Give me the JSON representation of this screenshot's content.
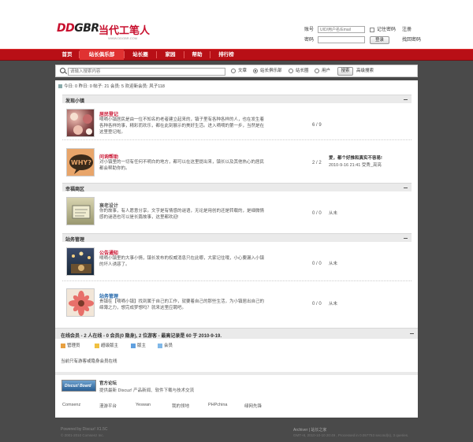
{
  "header": {
    "logo_text_1": "DD",
    "logo_text_2": "GBR",
    "logo_cn": "当代工笔人",
    "logo_sub": "WWW.DDGBR.COM"
  },
  "login": {
    "username_label": "账号",
    "username_placeholder": "UID/用户名/Email",
    "password_label": "密码",
    "remember_label": "记住密码",
    "register_label": "注册",
    "login_button": "登录",
    "forgot_label": "找回密码"
  },
  "nav": {
    "items": [
      "首页",
      "站长俱乐部",
      "站长圈",
      "家园",
      "帮助",
      "排行榜"
    ]
  },
  "search": {
    "placeholder": "请输入搜索内容",
    "options": [
      "文章",
      "站长俱乐部",
      "站长圈",
      "用户"
    ],
    "selected": "站长俱乐部",
    "button": "搜索",
    "advanced": "高级搜索"
  },
  "stats": {
    "text": "今日: 0  昨日: 0  帖子: 21  会员: 5  欢迎新会员: 风子118"
  },
  "sections": [
    {
      "title": "发现小镇",
      "forums": [
        {
          "name": "居民登记",
          "name_color": "#c8102e",
          "desc": "嘀嘀小镇居民是由一位不知名的老者建立起来的，镇子里有各种各样的人，也在发生着各种各样的事，精彩而欢乐，都在此刻展示的美好生活。进入嘀嘀的第一步，当然是在这里登记啦。",
          "count": "6 / 9",
          "last": ""
        },
        {
          "name": "问询帮助",
          "name_color": "#c8102e",
          "desc": "对小镇里的一切有任何不明白的地方，都可以在这里提出来，镇长以及其他热心的居民都会帮助你的。",
          "count": "2 / 2",
          "last_title": "爱，都个好推和真实不容易!",
          "last_meta": "2010-9-16 21:41 受秀_亮亮"
        }
      ]
    },
    {
      "title": "幸福商区",
      "forums": [
        {
          "name": "衰老设计",
          "name_color": "#555555",
          "desc": "你的故事，有人愿意分享。文字是有情感的谜语，无论是用创的还是转载的，是细微情感的谜语也可以是长篇故事，这里都欢迎!",
          "count": "0 / 0",
          "last": "从未"
        }
      ]
    },
    {
      "title": "站务管理",
      "forums": [
        {
          "name": "公告通知",
          "name_color": "#c8102e",
          "desc": "嘀嘀小镇里的大事小情，镇长发布的权威消息只在此哪，大家记住哦，小心要漏入小镇的坏人诱惑了。",
          "count": "0 / 0",
          "last": "从未"
        },
        {
          "name": "站务管理",
          "name_color": "#2266aa",
          "desc": "贵镇在【嘀嘀小镇】找到属于自己的工作，就要着自己的那些生活，为小镇居出自己的绵薄之力，想完成梦想吗？就来这里应聘吧。",
          "count": "0 / 0",
          "last": "从未"
        }
      ]
    }
  ],
  "online": {
    "title": "在线会员 - 2 人在线 - 0 会员(0 隐身), 2 位游客 - 最高记录是 60 于 2010-9-19.",
    "legend": [
      "管理员",
      "超级版主",
      "版主",
      "会员"
    ],
    "note": "当前只有游客或隐身会员在线"
  },
  "links": {
    "banner": "Discuz! Board",
    "title": "官方论坛",
    "desc": "提供最新 Discuz! 产品新闻、软件下载与技术交流",
    "partners": [
      "Comsenz",
      "漫游平台",
      "Yeswan",
      "我的领地",
      "PHPchina",
      "绿网先锋"
    ]
  },
  "footer": {
    "powered": "Powered by Discuz! X1.5C",
    "copyright": "© 2001-2010 Comsenz Inc.",
    "right1": "Archiver | 站长之家",
    "right2": "GMT+8, 2010-10-10 20:49 , Processed in 0.057753 second(s), 3 queries."
  }
}
